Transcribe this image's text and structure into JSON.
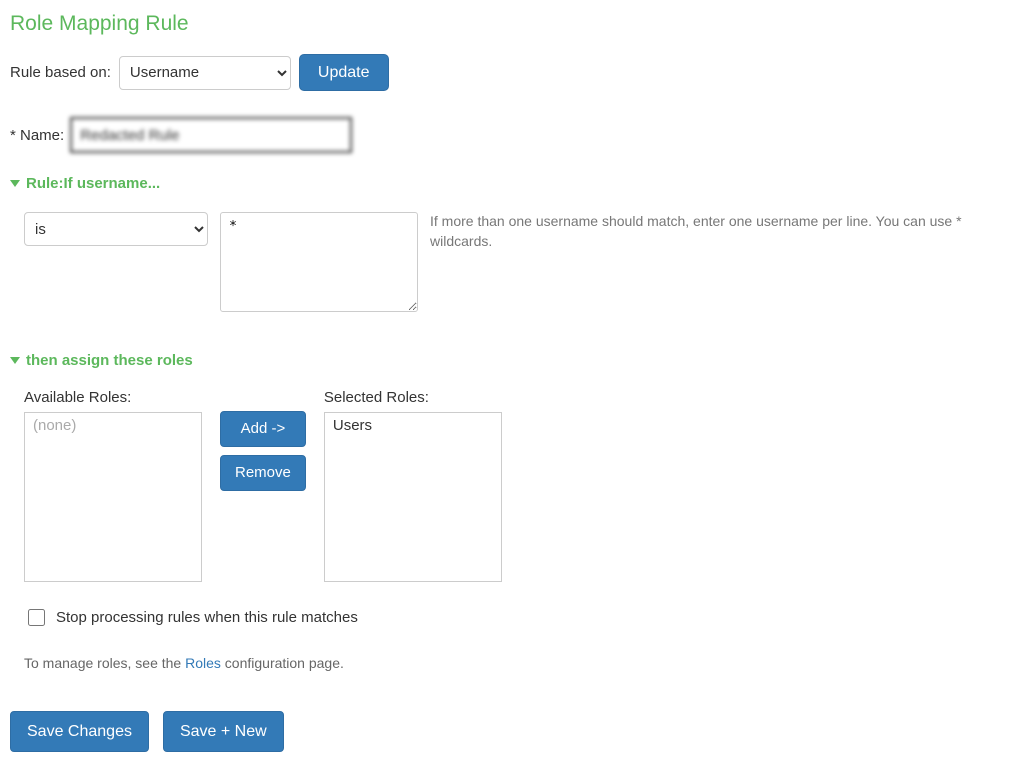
{
  "title": "Role Mapping Rule",
  "ruleBased": {
    "label": "Rule based on:",
    "selected": "Username",
    "updateLabel": "Update"
  },
  "nameField": {
    "label": "* Name:",
    "value": "Redacted Rule"
  },
  "ruleSection": {
    "header": "Rule:If username...",
    "condition": {
      "selected": "is"
    },
    "pattern": "*",
    "hint": "If more than one username should match, enter one username per line. You can use * wildcards."
  },
  "assignSection": {
    "header": "then assign these roles",
    "availableLabel": "Available Roles:",
    "availablePlaceholder": "(none)",
    "selectedLabel": "Selected Roles:",
    "selectedItems": {
      "0": "Users"
    },
    "addLabel": "Add ->",
    "removeLabel": "Remove"
  },
  "stopProcessing": {
    "label": "Stop processing rules when this rule matches",
    "checked": false
  },
  "manageNote": {
    "prefix": "To manage roles, see the ",
    "link": "Roles",
    "suffix": " configuration page."
  },
  "footer": {
    "save": "Save Changes",
    "saveNew": "Save + New"
  }
}
